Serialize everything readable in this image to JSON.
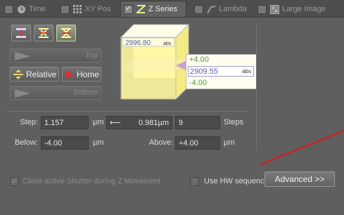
{
  "tabs": [
    {
      "label": "Time",
      "checked": false,
      "icon": "clock-icon"
    },
    {
      "label": "XY Pos",
      "checked": false,
      "icon": "grid-dots-icon"
    },
    {
      "label": "Z Series",
      "checked": true,
      "icon": "z-stack-icon"
    },
    {
      "label": "Lambda",
      "checked": false,
      "icon": "lambda-icon"
    },
    {
      "label": "Large Image",
      "checked": false,
      "icon": "large-image-icon"
    }
  ],
  "zseries": {
    "buttons": {
      "top": "Top",
      "relative": "Relative",
      "home": "Home",
      "bottom": "Bottom"
    },
    "position_readout": "2996.80",
    "position_readout_unit": "abs",
    "range_upper": "+4.00",
    "current_position": "2909.55",
    "current_position_unit": "abs",
    "range_lower": "-4.00",
    "step_label": "Step:",
    "step_value": "1.157",
    "step_unit": "µm",
    "computed_step": "0.981µm",
    "steps_value": "9",
    "steps_label": "Steps",
    "below_label": "Below:",
    "below_value": "-4.00",
    "below_unit": "µm",
    "above_label": "Above:",
    "above_value": "+4.00",
    "above_unit": "µm",
    "close_shutter_label": "Close active Shutter during Z Movement",
    "close_shutter_checked": true,
    "hw_sequencer_label": "Use HW sequencer",
    "hw_sequencer_checked": false,
    "advanced_label": "Advanced >>"
  },
  "colors": {
    "accent_yellow": "#fff8a0",
    "home_red": "#e03030",
    "annotation_red": "#e01818"
  }
}
